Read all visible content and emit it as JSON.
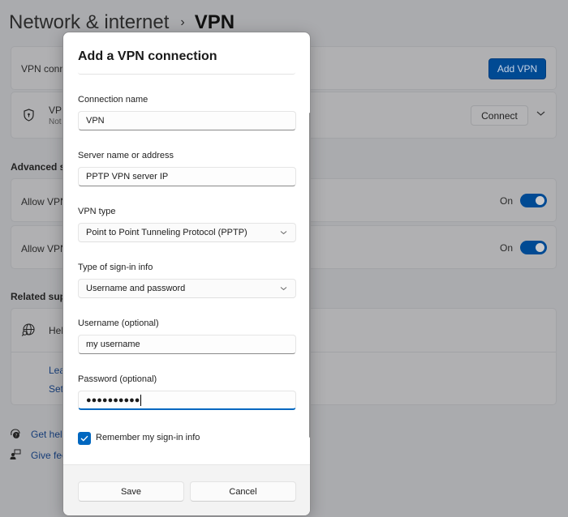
{
  "background": {
    "breadcrumb": {
      "parent": "Network & internet",
      "separator": "›",
      "current": "VPN"
    },
    "vpn_connections_card": {
      "label": "VPN conne",
      "add_button": "Add VPN"
    },
    "vpn_entry_card": {
      "name": "VPN",
      "status": "Not",
      "connect_button": "Connect"
    },
    "advanced_section": {
      "heading": "Advanced se",
      "items": [
        {
          "label": "Allow VPN",
          "state_label": "On",
          "enabled": true
        },
        {
          "label": "Allow VPN",
          "state_label": "On",
          "enabled": true
        }
      ]
    },
    "related_support": {
      "heading": "Related supp",
      "help_label": "Hel",
      "links": [
        "Lea",
        "Set"
      ]
    },
    "footer_links": [
      {
        "label": "Get help",
        "icon": "get-help-icon"
      },
      {
        "label": "Give fee",
        "icon": "feedback-icon"
      }
    ]
  },
  "dialog": {
    "title": "Add a VPN connection",
    "fields": {
      "connection_name": {
        "label": "Connection name",
        "value": "VPN"
      },
      "server": {
        "label": "Server name or address",
        "value": "PPTP VPN server IP"
      },
      "vpn_type": {
        "label": "VPN type",
        "value": "Point to Point Tunneling Protocol (PPTP)"
      },
      "signin_type": {
        "label": "Type of sign-in info",
        "value": "Username and password"
      },
      "username": {
        "label": "Username (optional)",
        "value": "my username"
      },
      "password": {
        "label": "Password (optional)",
        "value": "●●●●●●●●●●"
      }
    },
    "remember": {
      "label": "Remember my sign-in info",
      "checked": true
    },
    "buttons": {
      "save": "Save",
      "cancel": "Cancel"
    }
  },
  "colors": {
    "accent": "#0067c0",
    "dim_accent": "#004a93"
  }
}
